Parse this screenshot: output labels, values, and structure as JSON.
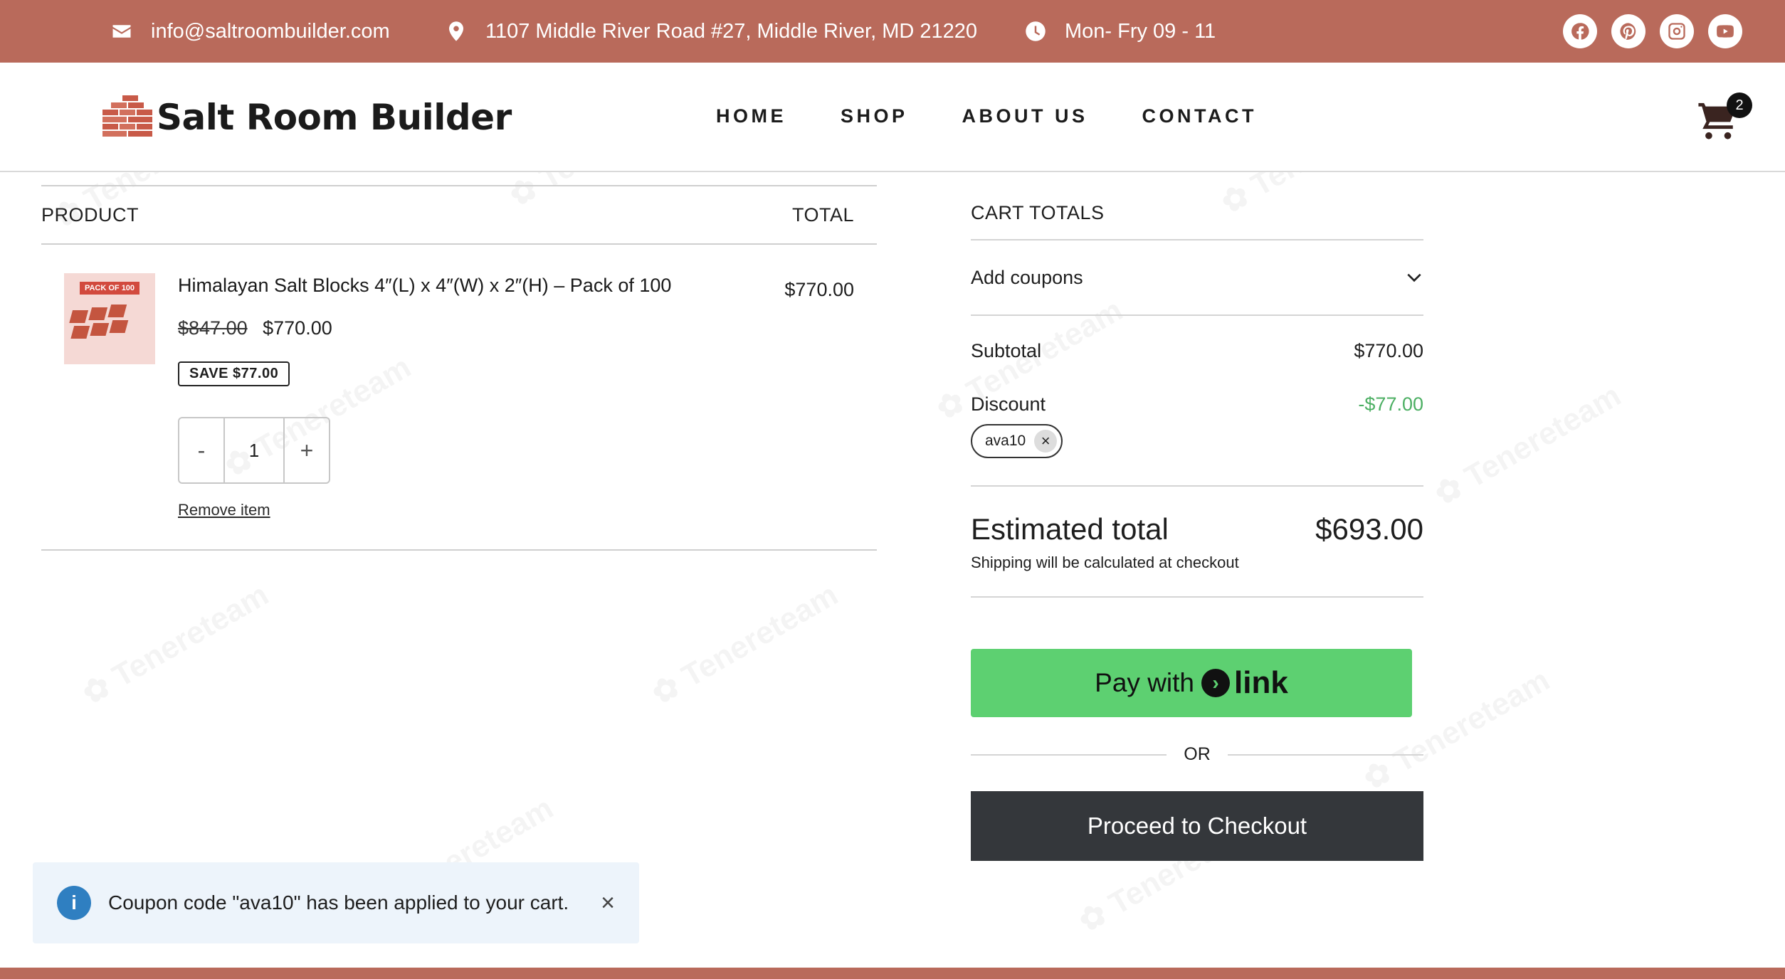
{
  "topbar": {
    "email": "info@saltroombuilder.com",
    "address": "1107 Middle River Road #27, Middle River, MD 21220",
    "hours": "Mon- Fry 09 - 11"
  },
  "header": {
    "logo_text": "Salt Room Builder",
    "nav": [
      "HOME",
      "SHOP",
      "ABOUT US",
      "CONTACT"
    ],
    "cart_count": "2"
  },
  "cart": {
    "product_header": "PRODUCT",
    "total_header": "TOTAL",
    "item": {
      "thumb_tag": "PACK OF 100",
      "title": "Himalayan Salt Blocks 4″(L) x 4″(W) x 2″(H) – Pack of 100",
      "old_price": "$847.00",
      "price": "$770.00",
      "save": "SAVE $77.00",
      "qty_minus": "-",
      "qty_value": "1",
      "qty_plus": "+",
      "remove": "Remove item",
      "line_total": "$770.00"
    }
  },
  "totals": {
    "title": "CART TOTALS",
    "coupons_label": "Add coupons",
    "subtotal_label": "Subtotal",
    "subtotal": "$770.00",
    "discount_label": "Discount",
    "discount": "-$77.00",
    "coupon_code": "ava10",
    "estimated_label": "Estimated total",
    "estimated": "$693.00",
    "shipping_note": "Shipping will be calculated at checkout",
    "pay_text": "Pay with",
    "pay_brand": "link",
    "or": "OR",
    "checkout": "Proceed to Checkout"
  },
  "notice": {
    "message": "Coupon code \"ava10\" has been applied to your cart."
  },
  "colors": {
    "brand": "#b96a5b",
    "pay": "#5dd071",
    "checkout": "#34373b",
    "discount": "#4caf63"
  },
  "icons": [
    "envelope-icon",
    "map-pin-icon",
    "clock-icon",
    "facebook-icon",
    "pinterest-icon",
    "instagram-icon",
    "youtube-icon",
    "cart-icon",
    "chevron-down-icon",
    "info-icon",
    "close-icon"
  ]
}
